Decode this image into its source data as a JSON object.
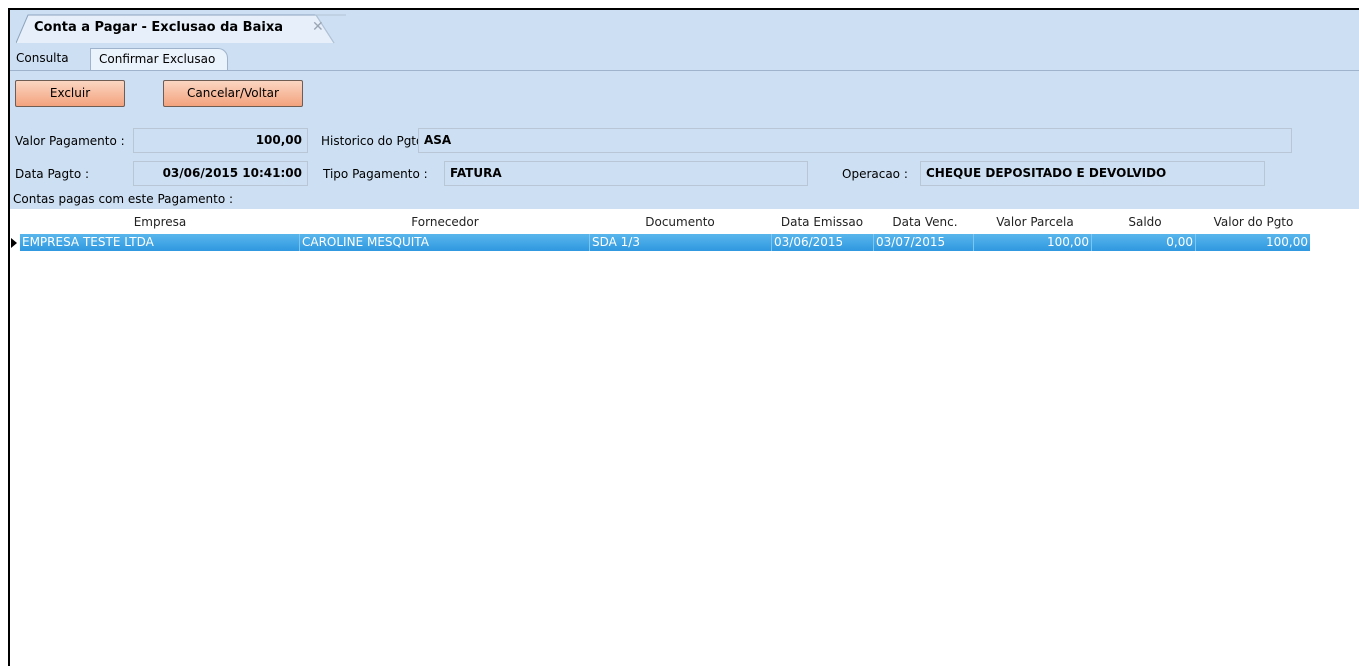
{
  "window": {
    "tab_title": "Conta a Pagar - Exclusao da Baixa",
    "close_glyph": "✕"
  },
  "subtabs": [
    {
      "label": "Consulta"
    },
    {
      "label": "Confirmar Exclusao"
    }
  ],
  "toolbar": {
    "excluir_label": "Excluir",
    "cancelar_label": "Cancelar/Voltar"
  },
  "form": {
    "valor_pagamento_label": "Valor Pagamento :",
    "valor_pagamento": "100,00",
    "historico_label": "Historico do Pgto :",
    "historico": "ASA",
    "data_pagto_label": "Data Pagto :",
    "data_pagto": "03/06/2015 10:41:00",
    "tipo_label": "Tipo Pagamento :",
    "tipo": "FATURA",
    "operacao_label": "Operacao :",
    "operacao": "CHEQUE DEPOSITADO E DEVOLVIDO",
    "contas_label": "Contas pagas com este Pagamento :"
  },
  "grid": {
    "columns": [
      "Empresa",
      "Fornecedor",
      "Documento",
      "Data Emissao",
      "Data Venc.",
      "Valor Parcela",
      "Saldo",
      "Valor do Pgto"
    ],
    "rows": [
      [
        "EMPRESA TESTE LTDA",
        "CAROLINE MESQUITA",
        "SDA 1/3",
        "03/06/2015",
        "03/07/2015",
        "100,00",
        "0,00",
        "100,00"
      ]
    ]
  },
  "colors": {
    "band": "#cddff3",
    "selected_row": "#3aa0e6",
    "button": "#f3a27d"
  }
}
